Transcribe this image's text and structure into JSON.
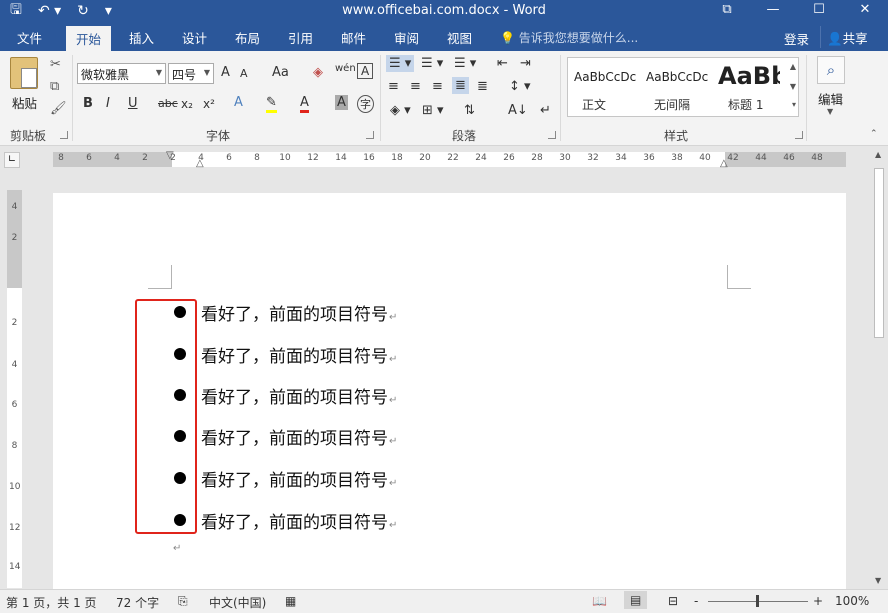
{
  "window": {
    "title": "www.officebai.com.docx - Word",
    "quick_access": [
      "save-icon",
      "undo-icon",
      "redo-icon",
      "customize-icon"
    ],
    "controls": [
      "ribbon-display-icon",
      "minimize-icon",
      "maximize-icon",
      "close-icon"
    ]
  },
  "tabs": {
    "items": [
      "文件",
      "开始",
      "插入",
      "设计",
      "布局",
      "引用",
      "邮件",
      "审阅",
      "视图"
    ],
    "active": "开始",
    "tell_me": "告诉我您想要做什么...",
    "login": "登录",
    "share": "共享"
  },
  "ribbon": {
    "clipboard": {
      "label": "剪贴板",
      "paste": "粘贴"
    },
    "font": {
      "label": "字体",
      "font_name": "微软雅黑",
      "font_size": "四号",
      "bold": "B",
      "italic": "I",
      "underline": "U",
      "strike": "abc",
      "subscript": "x₂",
      "superscript": "x²",
      "grow": "A",
      "shrink": "A",
      "case": "Aa",
      "phonetic": "wén",
      "border": "A"
    },
    "paragraph": {
      "label": "段落"
    },
    "styles": {
      "label": "样式",
      "items": [
        {
          "sample": "AaBbCcDc",
          "name": "正文"
        },
        {
          "sample": "AaBbCcDc",
          "name": "无间隔"
        },
        {
          "sample": "AaBb",
          "name": "标题 1"
        }
      ]
    },
    "editing": {
      "label": "编辑"
    }
  },
  "ruler": {
    "h_ticks": [
      "8",
      "6",
      "4",
      "2",
      "2",
      "4",
      "6",
      "8",
      "10",
      "12",
      "14",
      "16",
      "18",
      "20",
      "22",
      "24",
      "26",
      "28",
      "30",
      "32",
      "34",
      "36",
      "38",
      "40",
      "42",
      "44",
      "46",
      "48"
    ],
    "v_ticks": [
      "4",
      "2",
      "2",
      "4",
      "6",
      "8",
      "10",
      "12",
      "14"
    ]
  },
  "document": {
    "items": [
      "看好了，前面的项目符号",
      "看好了，前面的项目符号",
      "看好了，前面的项目符号",
      "看好了，前面的项目符号",
      "看好了，前面的项目符号",
      "看好了，前面的项目符号"
    ],
    "paragraph_mark": "↵"
  },
  "status": {
    "page": "第 1 页，共 1 页",
    "words": "72 个字",
    "language": "中文(中国)",
    "zoom": "100%",
    "zoom_minus": "-",
    "zoom_plus": "+"
  },
  "colors": {
    "brand": "#2b579a",
    "highlight_box": "#e0241b"
  }
}
